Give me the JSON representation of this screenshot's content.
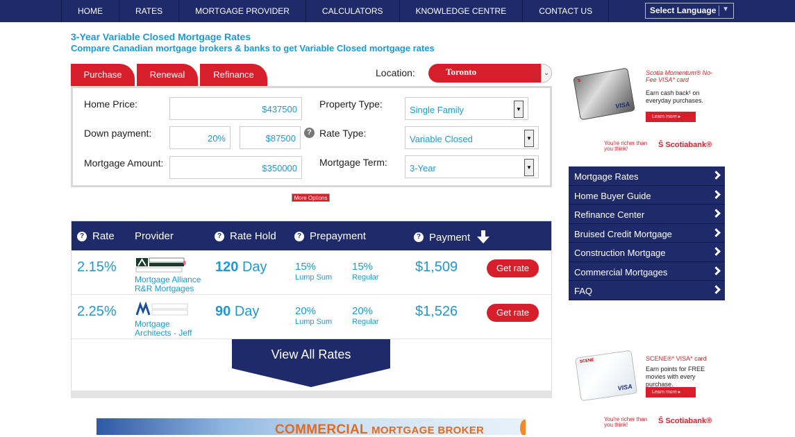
{
  "nav": {
    "items": [
      "HOME",
      "RATES",
      "MORTGAGE PROVIDER",
      "CALCULATORS",
      "KNOWLEDGE CENTRE",
      "CONTACT US"
    ],
    "language": "Select Language"
  },
  "header": {
    "title": "3-Year Variable Closed Mortgage Rates",
    "subtitle": "Compare Canadian mortgage brokers & banks to get Variable Closed mortgage rates"
  },
  "tabs": [
    "Purchase",
    "Renewal",
    "Refinance"
  ],
  "location": {
    "label": "Location:",
    "value": "Toronto"
  },
  "form": {
    "home_price_label": "Home Price:",
    "home_price": "$437500",
    "down_payment_label": "Down payment:",
    "down_payment_pct": "20%",
    "down_payment_amt": "$87500",
    "mortgage_amount_label": "Mortgage Amount:",
    "mortgage_amount": "$350000",
    "property_type_label": "Property Type:",
    "property_type": "Single Family",
    "rate_type_label": "Rate Type:",
    "rate_type": "Variable Closed",
    "term_label": "Mortgage Term:",
    "term": "3-Year",
    "more_options": "More Options"
  },
  "table": {
    "headers": {
      "rate": "Rate",
      "provider": "Provider",
      "rate_hold": "Rate Hold",
      "prepayment": "Prepayment",
      "payment": "Payment"
    },
    "rows": [
      {
        "rate": "2.15%",
        "provider": "Mortgage Alliance R&R Mortgages",
        "hold_num": "120",
        "hold_unit": "Day",
        "lump_pct": "15%",
        "lump_label": "Lump Sum",
        "reg_pct": "15%",
        "reg_label": "Regular",
        "payment": "$1,509",
        "button": "Get rate"
      },
      {
        "rate": "2.25%",
        "provider": "Mortgage Architects - Jeff",
        "hold_num": "90",
        "hold_unit": "Day",
        "lump_pct": "20%",
        "lump_label": "Lump Sum",
        "reg_pct": "20%",
        "reg_label": "Regular",
        "payment": "$1,526",
        "button": "Get rate"
      }
    ],
    "view_all": "View All Rates"
  },
  "banner": {
    "text_big": "COMMERCIAL",
    "text_small": "MORTGAGE BROKER"
  },
  "ads": {
    "ad1": {
      "title": "Scotia Momentum® No-Fee VISA* card",
      "body": "Earn cash back¹ on everyday purchases.",
      "button": "Learn more",
      "tagline": "You're richer than you think!",
      "brand": "Scotiabank®"
    },
    "ad2": {
      "title": "SCENE®* VISA* card",
      "body": "Earn points for FREE movies with every purchase.",
      "button": "Learn more",
      "tagline": "You're richer than you think!",
      "brand": "Scotiabank®"
    }
  },
  "sidebar": {
    "items": [
      "Mortgage Rates",
      "Home Buyer Guide",
      "Refinance Center",
      "Bruised Credit Mortgage",
      "Construction Mortgage",
      "Commercial Mortgages",
      "FAQ"
    ]
  },
  "colors": {
    "nav": "#1f2a6b",
    "accent_red": "#d71f2c",
    "link_blue": "#1b9ad6"
  }
}
